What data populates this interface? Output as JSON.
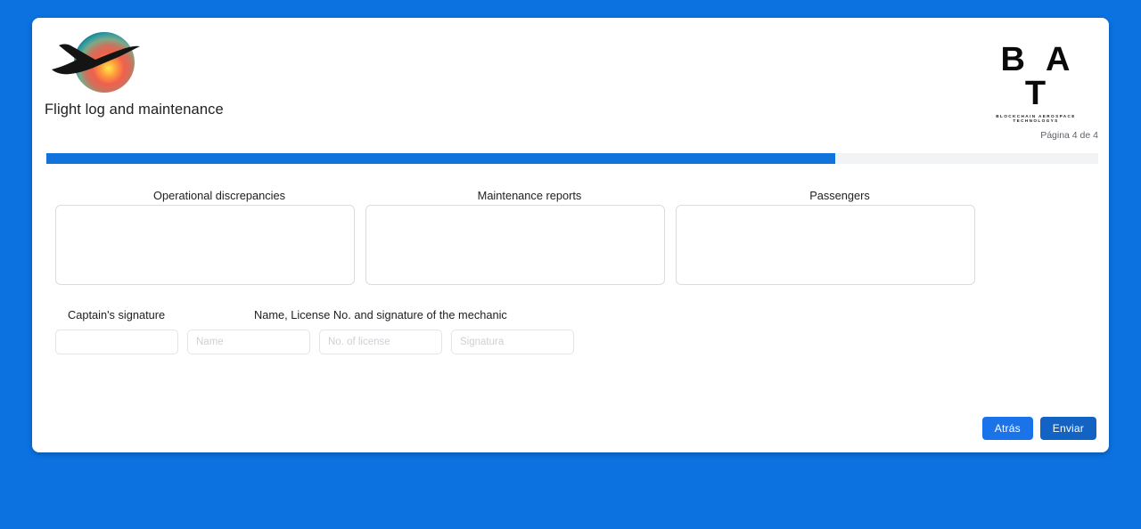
{
  "background_color": "#0b72e0",
  "brand": {
    "logo_icon": "airplane-over-gradient-circle-logo",
    "bat_wordmark": "B A T",
    "bat_tagline": "BLOCKCHAIN AEROSPACE TECHNOLOGYS"
  },
  "header": {
    "title": "Flight log and maintenance",
    "page_counter": "Página 4 de 4"
  },
  "progress": {
    "percent": 75,
    "fill_color": "#1273dc",
    "track_color": "#f1f3f4"
  },
  "sections": [
    {
      "label": "Operational discrepancies",
      "value": "",
      "placeholder": ""
    },
    {
      "label": "Maintenance reports",
      "value": "",
      "placeholder": ""
    },
    {
      "label": "Passengers",
      "value": "",
      "placeholder": ""
    }
  ],
  "signature": {
    "captain_label": "Captain's signature",
    "mechanic_label": "Name, License No. and signature of the mechanic",
    "fields": [
      {
        "name": "captain-signature",
        "value": "",
        "placeholder": ""
      },
      {
        "name": "mechanic-name",
        "value": "",
        "placeholder": "Name"
      },
      {
        "name": "mechanic-license",
        "value": "",
        "placeholder": "No. of license"
      },
      {
        "name": "mechanic-signature",
        "value": "",
        "placeholder": "Signatura"
      }
    ]
  },
  "footer": {
    "back_label": "Atrás",
    "submit_label": "Enviar",
    "back_color": "#1a73e8",
    "submit_color": "#1263c4"
  }
}
